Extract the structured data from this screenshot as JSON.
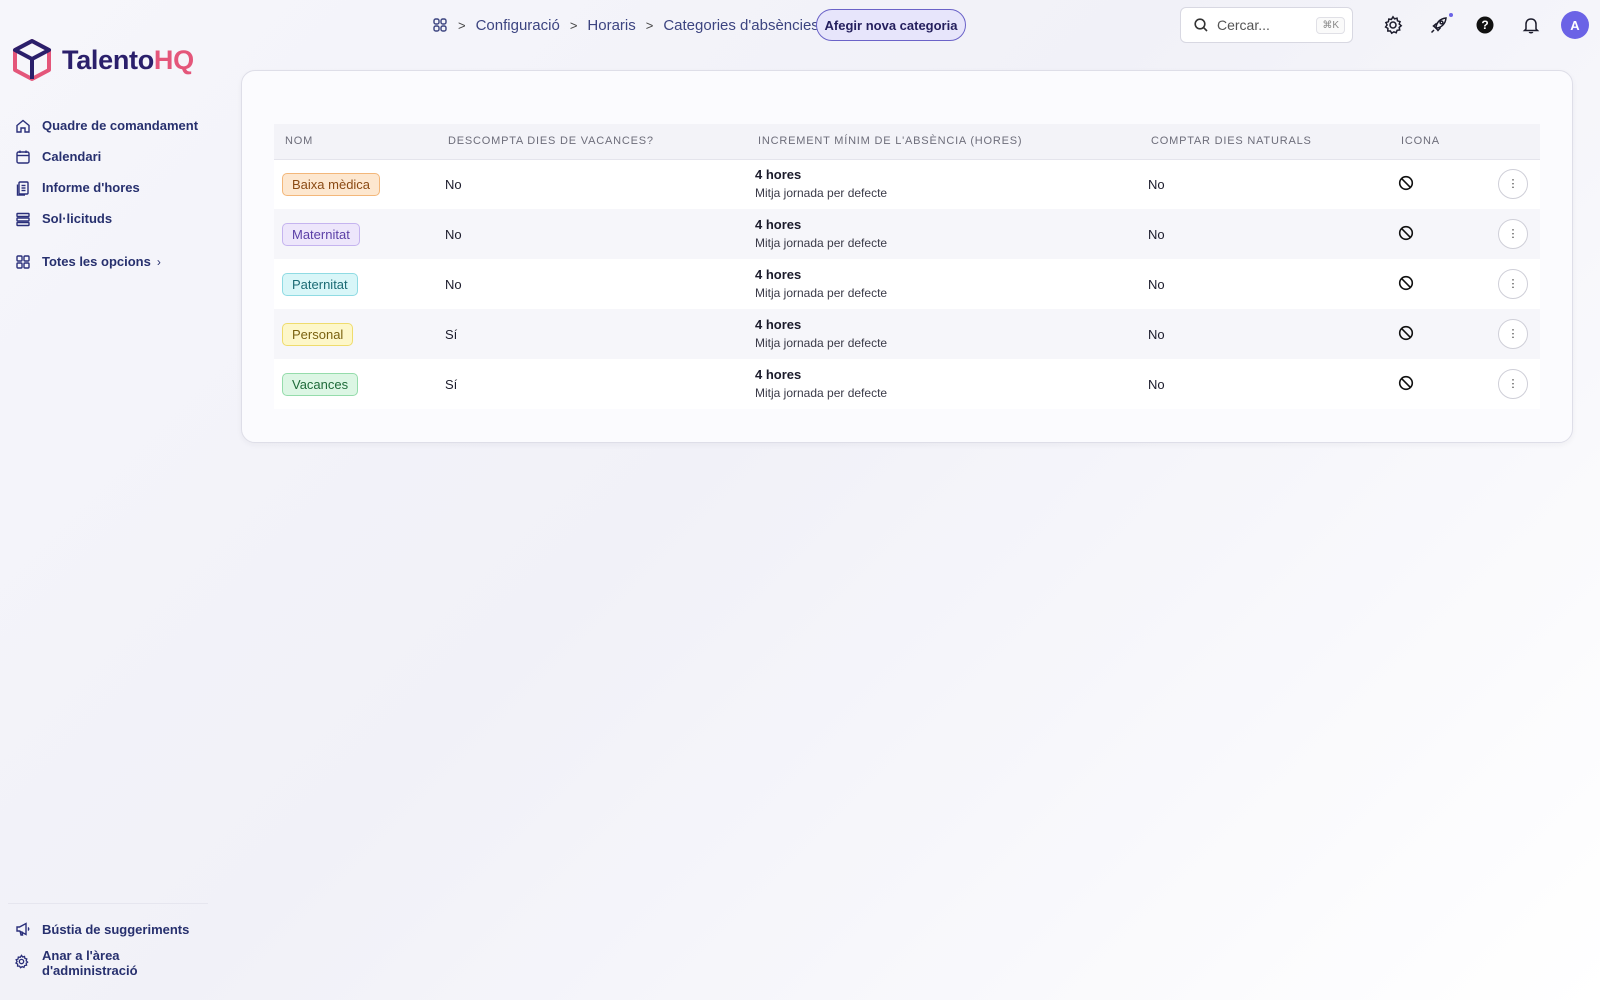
{
  "brand": {
    "name_part1": "Talento",
    "name_part2": "HQ",
    "accent": "#e4567a",
    "primary": "#2a1f6b"
  },
  "sidebar": {
    "items": [
      {
        "label": "Quadre de comandament",
        "icon": "home-icon"
      },
      {
        "label": "Calendari",
        "icon": "calendar-icon"
      },
      {
        "label": "Informe d'hores",
        "icon": "report-icon"
      },
      {
        "label": "Sol·licituds",
        "icon": "list-icon"
      }
    ],
    "all_options": "Totes les opcions",
    "feedback": "Bústia de suggeriments",
    "admin": "Anar a l'àrea d'administració"
  },
  "breadcrumb": {
    "items": [
      "Configuració",
      "Horaris",
      "Categories d'absències"
    ]
  },
  "header": {
    "add_button": "Afegir nova categoria",
    "search_placeholder": "Cercar...",
    "search_shortcut": "⌘K",
    "avatar_initial": "A"
  },
  "table": {
    "columns": [
      "Nom",
      "Descompta dies de vacances?",
      "Increment mínim de l'absència (hores)",
      "Comptar dies naturals",
      "Icona"
    ],
    "rows": [
      {
        "name": "Baixa mèdica",
        "badge_bg": "#fde7cf",
        "badge_border": "#f3b77a",
        "badge_color": "#8a4a14",
        "discount": "No",
        "increment": "4 hores",
        "increment_note": "Mitja jornada per defecte",
        "natural_days": "No",
        "icon": "ban-icon"
      },
      {
        "name": "Maternitat",
        "badge_bg": "#ede6fb",
        "badge_border": "#c5b4ef",
        "badge_color": "#5b3fa6",
        "discount": "No",
        "increment": "4 hores",
        "increment_note": "Mitja jornada per defecte",
        "natural_days": "No",
        "icon": "ban-icon"
      },
      {
        "name": "Paternitat",
        "badge_bg": "#d8f6f8",
        "badge_border": "#8fdbe3",
        "badge_color": "#1c6b74",
        "discount": "No",
        "increment": "4 hores",
        "increment_note": "Mitja jornada per defecte",
        "natural_days": "No",
        "icon": "ban-icon"
      },
      {
        "name": "Personal",
        "badge_bg": "#fdf7c9",
        "badge_border": "#efdc6d",
        "badge_color": "#7a6210",
        "discount": "Sí",
        "increment": "4 hores",
        "increment_note": "Mitja jornada per defecte",
        "natural_days": "No",
        "icon": "ban-icon"
      },
      {
        "name": "Vacances",
        "badge_bg": "#dcf6e4",
        "badge_border": "#95dcab",
        "badge_color": "#1f6b3a",
        "discount": "Sí",
        "increment": "4 hores",
        "increment_note": "Mitja jornada per defecte",
        "natural_days": "No",
        "icon": "ban-icon"
      }
    ]
  }
}
